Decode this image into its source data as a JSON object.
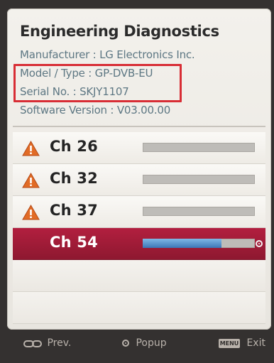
{
  "title": "Engineering Diagnostics",
  "info": {
    "manufacturer": "Manufacturer : LG Electronics  Inc.",
    "model": "Model / Type : GP-DVB-EU",
    "serial": "Serial No. : SKJY1107",
    "software": "Software Version : V03.00.00"
  },
  "channels": [
    {
      "label": "Ch 26",
      "warning": true,
      "signal_fraction": 0.0
    },
    {
      "label": "Ch 32",
      "warning": true,
      "signal_fraction": 0.0
    },
    {
      "label": "Ch 37",
      "warning": true,
      "signal_fraction": 0.0
    },
    {
      "label": "Ch 54",
      "warning": false,
      "selected": true,
      "signal_fraction": 0.7
    }
  ],
  "footer": {
    "prev": "Prev.",
    "popup": "Popup",
    "menu_key": "MENU",
    "exit": "Exit"
  },
  "colors": {
    "highlight": "#d82d35",
    "selected_row": "#a11d39",
    "signal_fill": "#3c77b7",
    "info_text": "#5d7783"
  },
  "icons": {
    "warning": "warning-triangle-icon",
    "selected": "selected-dot-icon",
    "prev": "prev-icon",
    "popup": "popup-icon",
    "menu": "menu-key-icon"
  }
}
